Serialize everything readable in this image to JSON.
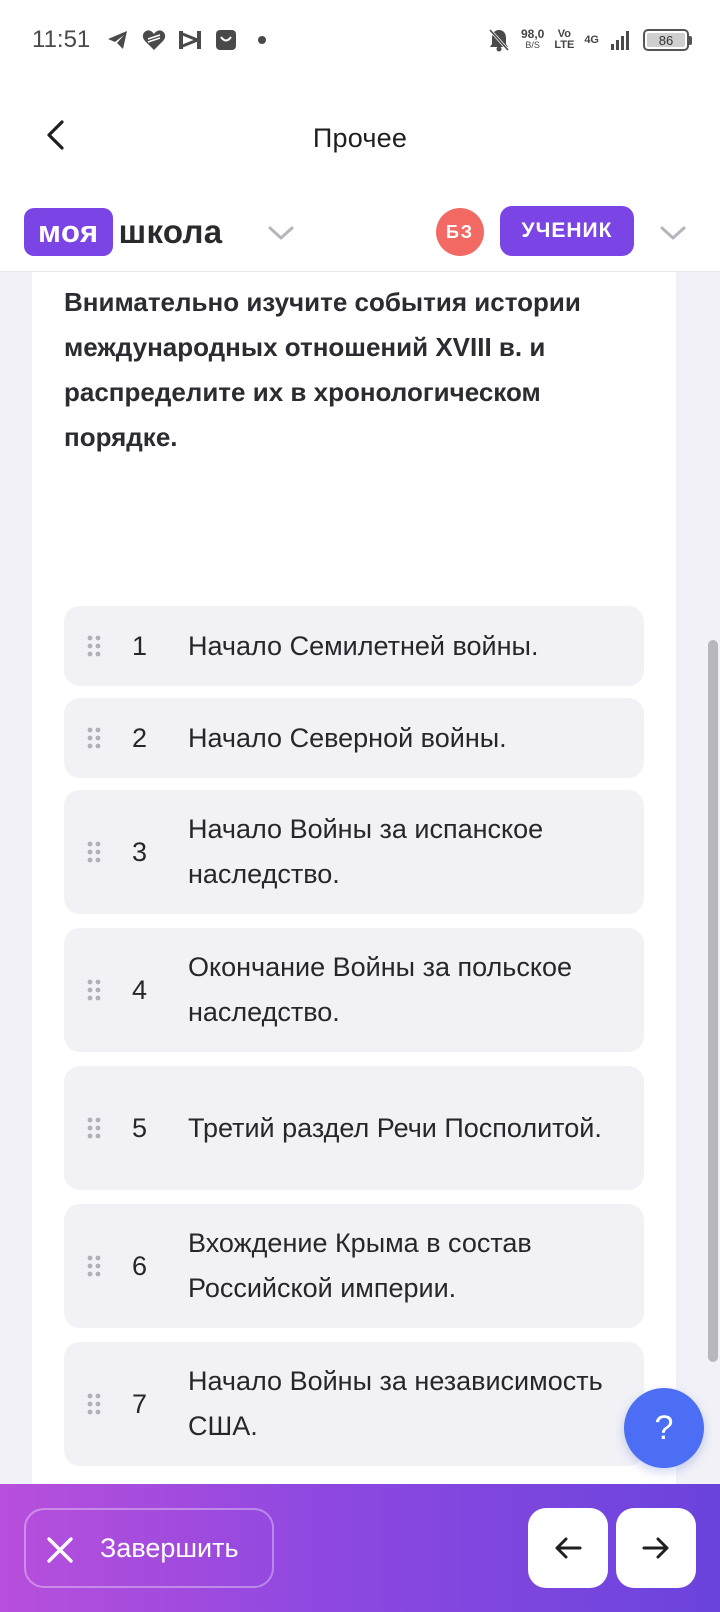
{
  "status_bar": {
    "time": "11:51",
    "net_speed_value": "98,0",
    "net_speed_unit": "B/S",
    "volte_top": "Vo",
    "volte_bottom": "LTE",
    "network": "4G",
    "battery": "86",
    "icons": [
      "telegram-icon",
      "heart-icon",
      "capcut-icon",
      "shopping-bag-icon",
      "dot-icon",
      "bell-muted-icon",
      "signal-icon",
      "battery-icon"
    ]
  },
  "app_bar": {
    "title": "Прочее",
    "back_icon": "chevron-left-icon"
  },
  "brand": {
    "logo_box": "моя",
    "logo_text": "школа",
    "avatar_initials": "БЗ",
    "role": "УЧЕНИК"
  },
  "question": {
    "text": "Внимательно изучите события истории международных отношений XVIII в. и распределите их в хронологическом порядке."
  },
  "items": [
    {
      "num": "1",
      "text": "Начало Семилетней войны."
    },
    {
      "num": "2",
      "text": "Начало Северной войны."
    },
    {
      "num": "3",
      "text": "Начало Войны за испанское наследство."
    },
    {
      "num": "4",
      "text": "Окончание Войны за польское наследство."
    },
    {
      "num": "5",
      "text": "Третий раздел Речи Посполитой."
    },
    {
      "num": "6",
      "text": "Вхождение Крыма в состав Российской империи."
    },
    {
      "num": "7",
      "text": "Начало Войны за независимость США."
    }
  ],
  "help": {
    "label": "?"
  },
  "bottom_bar": {
    "finish_label": "Завершить"
  },
  "colors": {
    "brand_purple": "#7b45e6",
    "avatar_red": "#f26a63",
    "help_blue": "#4b6ef5",
    "item_bg": "#f1f1f6"
  }
}
